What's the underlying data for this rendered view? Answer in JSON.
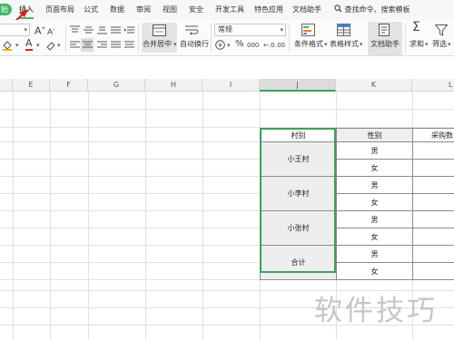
{
  "menu": {
    "start_tab": "始",
    "tabs": [
      "插入",
      "页面布局",
      "公式",
      "数据",
      "审阅",
      "视图",
      "安全",
      "开发工具",
      "特色应用",
      "文档助手"
    ],
    "active_tab": "插入",
    "search_command": "查找命令、搜索模板"
  },
  "ribbon": {
    "number_format": "常规",
    "merge_center_label": "合并居中",
    "wrap_text_label": "自动换行",
    "conditional_format_label": "条件格式",
    "table_style_label": "表格样式",
    "doc_assistant_label": "文档助手",
    "sum_label": "求和",
    "filter_label": "筛选",
    "font_grow": "A",
    "font_shrink": "A",
    "font_color_letter": "A",
    "percent": "%",
    "thousands": "000",
    "currency": "¥"
  },
  "columns": [
    "E",
    "F",
    "G",
    "H",
    "I",
    "J",
    "K",
    "L"
  ],
  "selected_column": "J",
  "table": {
    "header": [
      "村别",
      "性别",
      "采购数"
    ],
    "villages": [
      {
        "name": "小王村",
        "genders": [
          "男",
          "女"
        ]
      },
      {
        "name": "小李村",
        "genders": [
          "男",
          "女"
        ]
      },
      {
        "name": "小张村",
        "genders": [
          "男",
          "女"
        ]
      },
      {
        "name": "合计",
        "genders": [
          "男",
          "女"
        ]
      }
    ]
  },
  "watermark": "软件技巧",
  "colors": {
    "accent_green": "#48b56a",
    "selection_green": "#3f9e5a",
    "arrow_red": "#d42020"
  }
}
